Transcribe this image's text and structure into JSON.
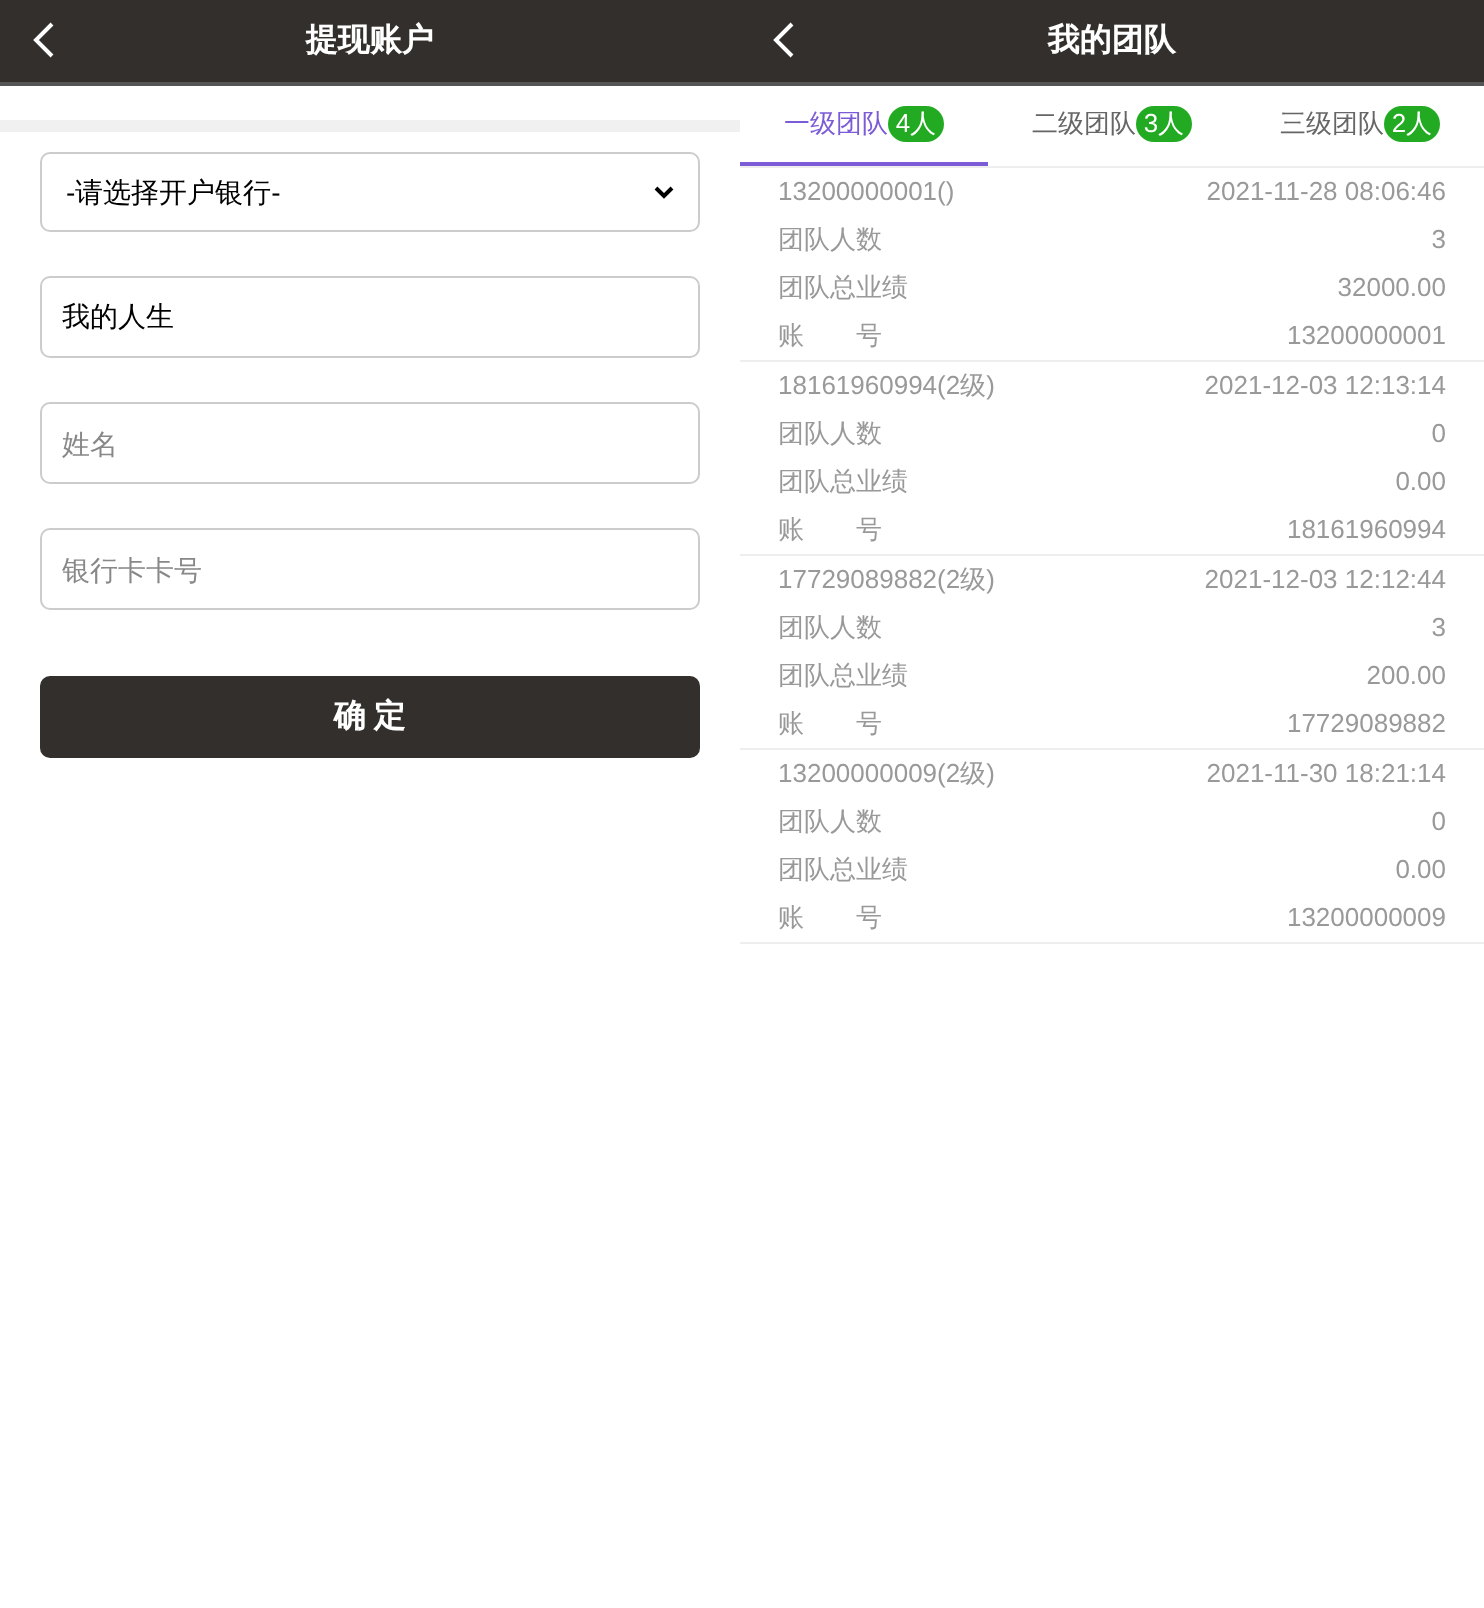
{
  "left_screen": {
    "title": "提现账户",
    "bank_select": {
      "value": "-请选择开户银行-"
    },
    "fields": [
      {
        "value": "我的人生"
      },
      {
        "placeholder": "姓名"
      },
      {
        "placeholder": "银行卡卡号"
      }
    ],
    "submit_button": "确 定"
  },
  "right_screen": {
    "title": "我的团队",
    "tabs": [
      {
        "label": "一级团队",
        "count": "4人",
        "selected": true
      },
      {
        "label": "二级团队",
        "count": "3人",
        "selected": false
      },
      {
        "label": "三级团队",
        "count": "2人",
        "selected": false
      }
    ],
    "members": [
      {
        "name": "13200000001()",
        "time": "2021-11-28 08:06:46",
        "rows": [
          {
            "label": "团队人数",
            "value": "3"
          },
          {
            "label": "团队总业绩",
            "value": "32000.00"
          },
          {
            "label": "账　　号",
            "value": "13200000001"
          }
        ]
      },
      {
        "name": "18161960994(2级)",
        "time": "2021-12-03 12:13:14",
        "rows": [
          {
            "label": "团队人数",
            "value": "0"
          },
          {
            "label": "团队总业绩",
            "value": "0.00"
          },
          {
            "label": "账　　号",
            "value": "18161960994"
          }
        ]
      },
      {
        "name": "17729089882(2级)",
        "time": "2021-12-03 12:12:44",
        "rows": [
          {
            "label": "团队人数",
            "value": "3"
          },
          {
            "label": "团队总业绩",
            "value": "200.00"
          },
          {
            "label": "账　　号",
            "value": "17729089882"
          }
        ]
      },
      {
        "name": "13200000009(2级)",
        "time": "2021-11-30 18:21:14",
        "rows": [
          {
            "label": "团队人数",
            "value": "0"
          },
          {
            "label": "团队总业绩",
            "value": "0.00"
          },
          {
            "label": "账　　号",
            "value": "13200000009"
          }
        ]
      }
    ]
  }
}
